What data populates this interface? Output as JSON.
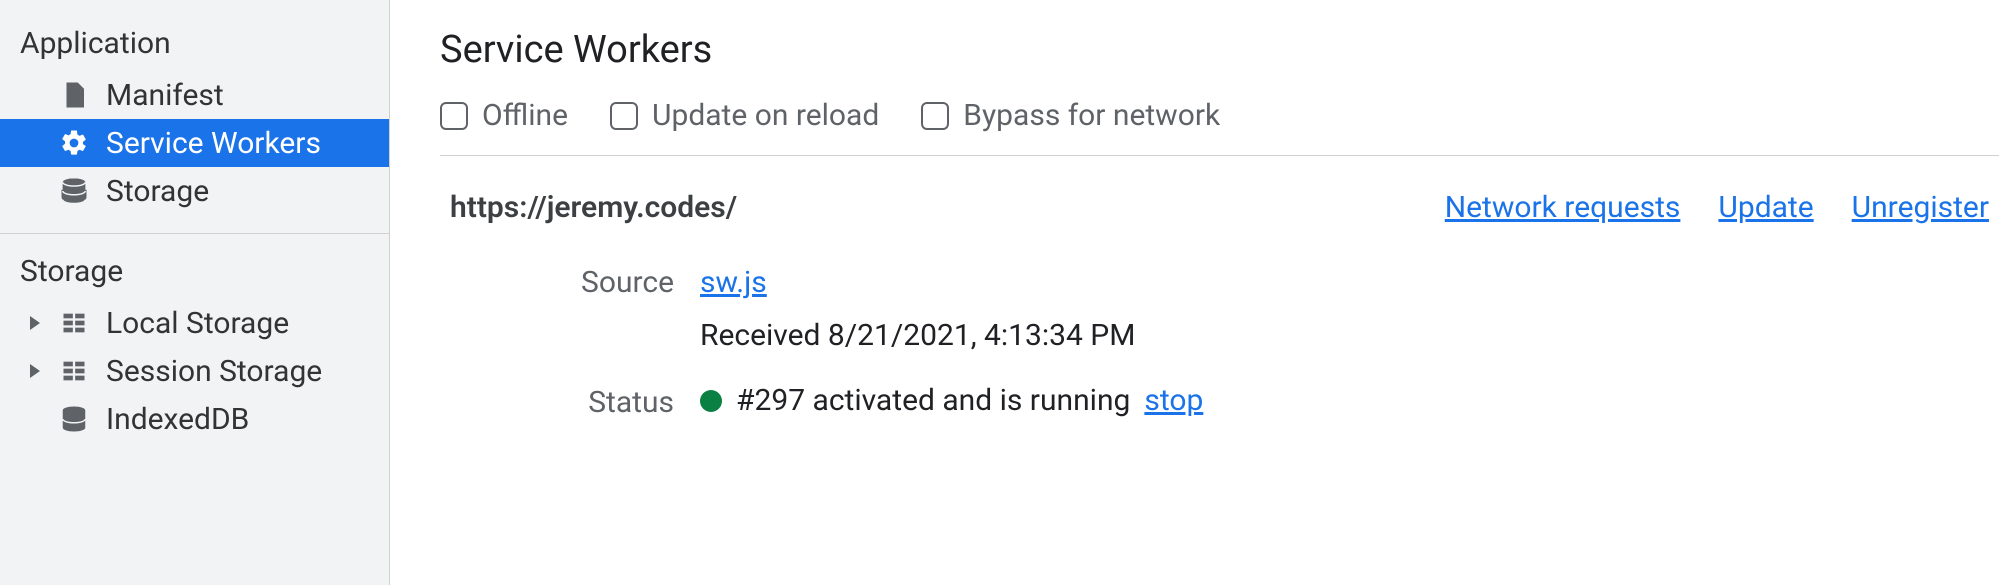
{
  "sidebar": {
    "section1": "Application",
    "items1": {
      "manifest": "Manifest",
      "service_workers": "Service Workers",
      "storage": "Storage"
    },
    "section2": "Storage",
    "items2": {
      "local_storage": "Local Storage",
      "session_storage": "Session Storage",
      "indexeddb": "IndexedDB"
    }
  },
  "main": {
    "title": "Service Workers",
    "options": {
      "offline": "Offline",
      "update_on_reload": "Update on reload",
      "bypass": "Bypass for network"
    },
    "origin": "https://jeremy.codes/",
    "links": {
      "network": "Network requests",
      "update": "Update",
      "unregister": "Unregister"
    },
    "labels": {
      "source": "Source",
      "status": "Status"
    },
    "source_file": "sw.js",
    "received": "Received 8/21/2021, 4:13:34 PM",
    "status_text": "#297 activated and is running",
    "stop": "stop"
  }
}
